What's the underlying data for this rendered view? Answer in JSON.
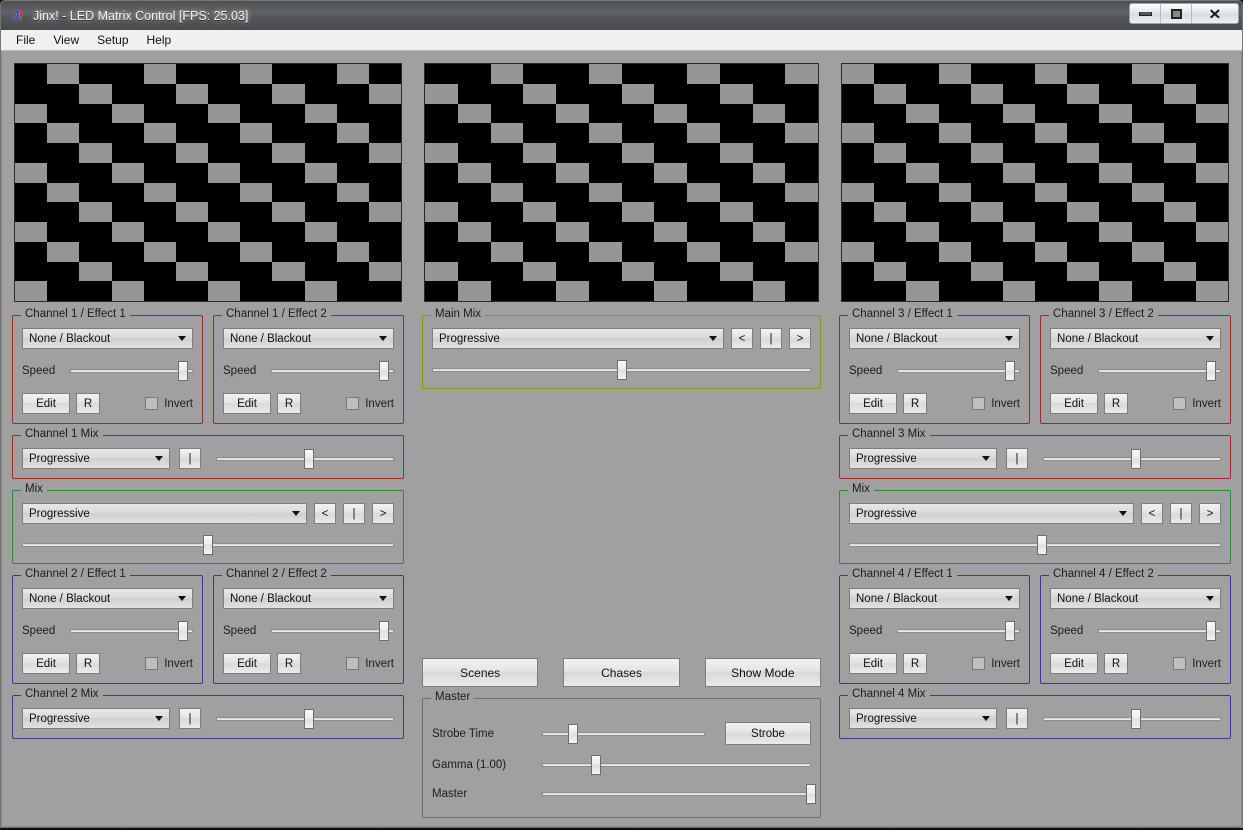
{
  "window": {
    "title": "Jinx! - LED Matrix Control [FPS: 25.03]",
    "icon_left": "J",
    "icon_right": "!",
    "buttons": {
      "minimize": "minimize-icon",
      "maximize": "maximize-icon",
      "close": "✕"
    }
  },
  "menu": {
    "items": [
      "File",
      "View",
      "Setup",
      "Help"
    ]
  },
  "colors": {
    "background": "#a0a0a0",
    "led_on": "#969696",
    "led_off": "#000000",
    "group_red": "#9e2b2b",
    "group_blue": "#3a3a96",
    "group_green": "#2e8b35",
    "group_yellow": "#94900f",
    "group_gray": "#6f6f6f"
  },
  "previews": [
    {
      "name": "output-preview-left",
      "columns": 12,
      "rows": 12,
      "phase": 1
    },
    {
      "name": "output-preview-center",
      "columns": 12,
      "rows": 12,
      "phase": 2
    },
    {
      "name": "output-preview-right",
      "columns": 12,
      "rows": 12,
      "phase": 0
    }
  ],
  "effect_panels": [
    {
      "legend": "Channel 1 / Effect 1",
      "effect": "None / Blackout",
      "speed_label": "Speed",
      "speed_value": 92,
      "edit": "Edit",
      "reset": "R",
      "invert": "Invert",
      "invert_checked": false,
      "color": "red"
    },
    {
      "legend": "Channel 1 / Effect 2",
      "effect": "None / Blackout",
      "speed_label": "Speed",
      "speed_value": 92,
      "edit": "Edit",
      "reset": "R",
      "invert": "Invert",
      "invert_checked": false,
      "color": "red"
    },
    {
      "legend": "Channel 2 / Effect 1",
      "effect": "None / Blackout",
      "speed_label": "Speed",
      "speed_value": 92,
      "edit": "Edit",
      "reset": "R",
      "invert": "Invert",
      "invert_checked": false,
      "color": "blue"
    },
    {
      "legend": "Channel 2 / Effect 2",
      "effect": "None / Blackout",
      "speed_label": "Speed",
      "speed_value": 92,
      "edit": "Edit",
      "reset": "R",
      "invert": "Invert",
      "invert_checked": false,
      "color": "blue"
    },
    {
      "legend": "Channel 3 / Effect 1",
      "effect": "None / Blackout",
      "speed_label": "Speed",
      "speed_value": 92,
      "edit": "Edit",
      "reset": "R",
      "invert": "Invert",
      "invert_checked": false,
      "color": "red"
    },
    {
      "legend": "Channel 3 / Effect 2",
      "effect": "None / Blackout",
      "speed_label": "Speed",
      "speed_value": 92,
      "edit": "Edit",
      "reset": "R",
      "invert": "Invert",
      "invert_checked": false,
      "color": "red"
    },
    {
      "legend": "Channel 4 / Effect 1",
      "effect": "None / Blackout",
      "speed_label": "Speed",
      "speed_value": 92,
      "edit": "Edit",
      "reset": "R",
      "invert": "Invert",
      "invert_checked": false,
      "color": "blue"
    },
    {
      "legend": "Channel 4 / Effect 2",
      "effect": "None / Blackout",
      "speed_label": "Speed",
      "speed_value": 92,
      "edit": "Edit",
      "reset": "R",
      "invert": "Invert",
      "invert_checked": false,
      "color": "blue"
    }
  ],
  "channel_mixes": [
    {
      "legend": "Channel 1 Mix",
      "mode": "Progressive",
      "center_button": "|",
      "fader": 52,
      "color": "red"
    },
    {
      "legend": "Channel 2 Mix",
      "mode": "Progressive",
      "center_button": "|",
      "fader": 52,
      "color": "blue"
    },
    {
      "legend": "Channel 3 Mix",
      "mode": "Progressive",
      "center_button": "|",
      "fader": 52,
      "color": "red"
    },
    {
      "legend": "Channel 4 Mix",
      "mode": "Progressive",
      "center_button": "|",
      "fader": 52,
      "color": "blue"
    }
  ],
  "mixes": [
    {
      "legend": "Mix",
      "mode": "Progressive",
      "prev_button": "<",
      "center_button": "|",
      "next_button": ">",
      "fader": 50,
      "color": "green"
    },
    {
      "legend": "Mix",
      "mode": "Progressive",
      "prev_button": "<",
      "center_button": "|",
      "next_button": ">",
      "fader": 52,
      "color": "green"
    }
  ],
  "main_mix": {
    "legend": "Main Mix",
    "mode": "Progressive",
    "prev_button": "<",
    "center_button": "|",
    "next_button": ">",
    "fader": 50,
    "color": "yellow"
  },
  "center_buttons": {
    "scenes": "Scenes",
    "chases": "Chases",
    "show_mode": "Show Mode"
  },
  "master": {
    "legend": "Master",
    "strobe_time_label": "Strobe Time",
    "strobe_time_value": 19,
    "strobe_button": "Strobe",
    "gamma_label": "Gamma (1.00)",
    "gamma_value": 20,
    "master_label": "Master",
    "master_value": 100
  }
}
